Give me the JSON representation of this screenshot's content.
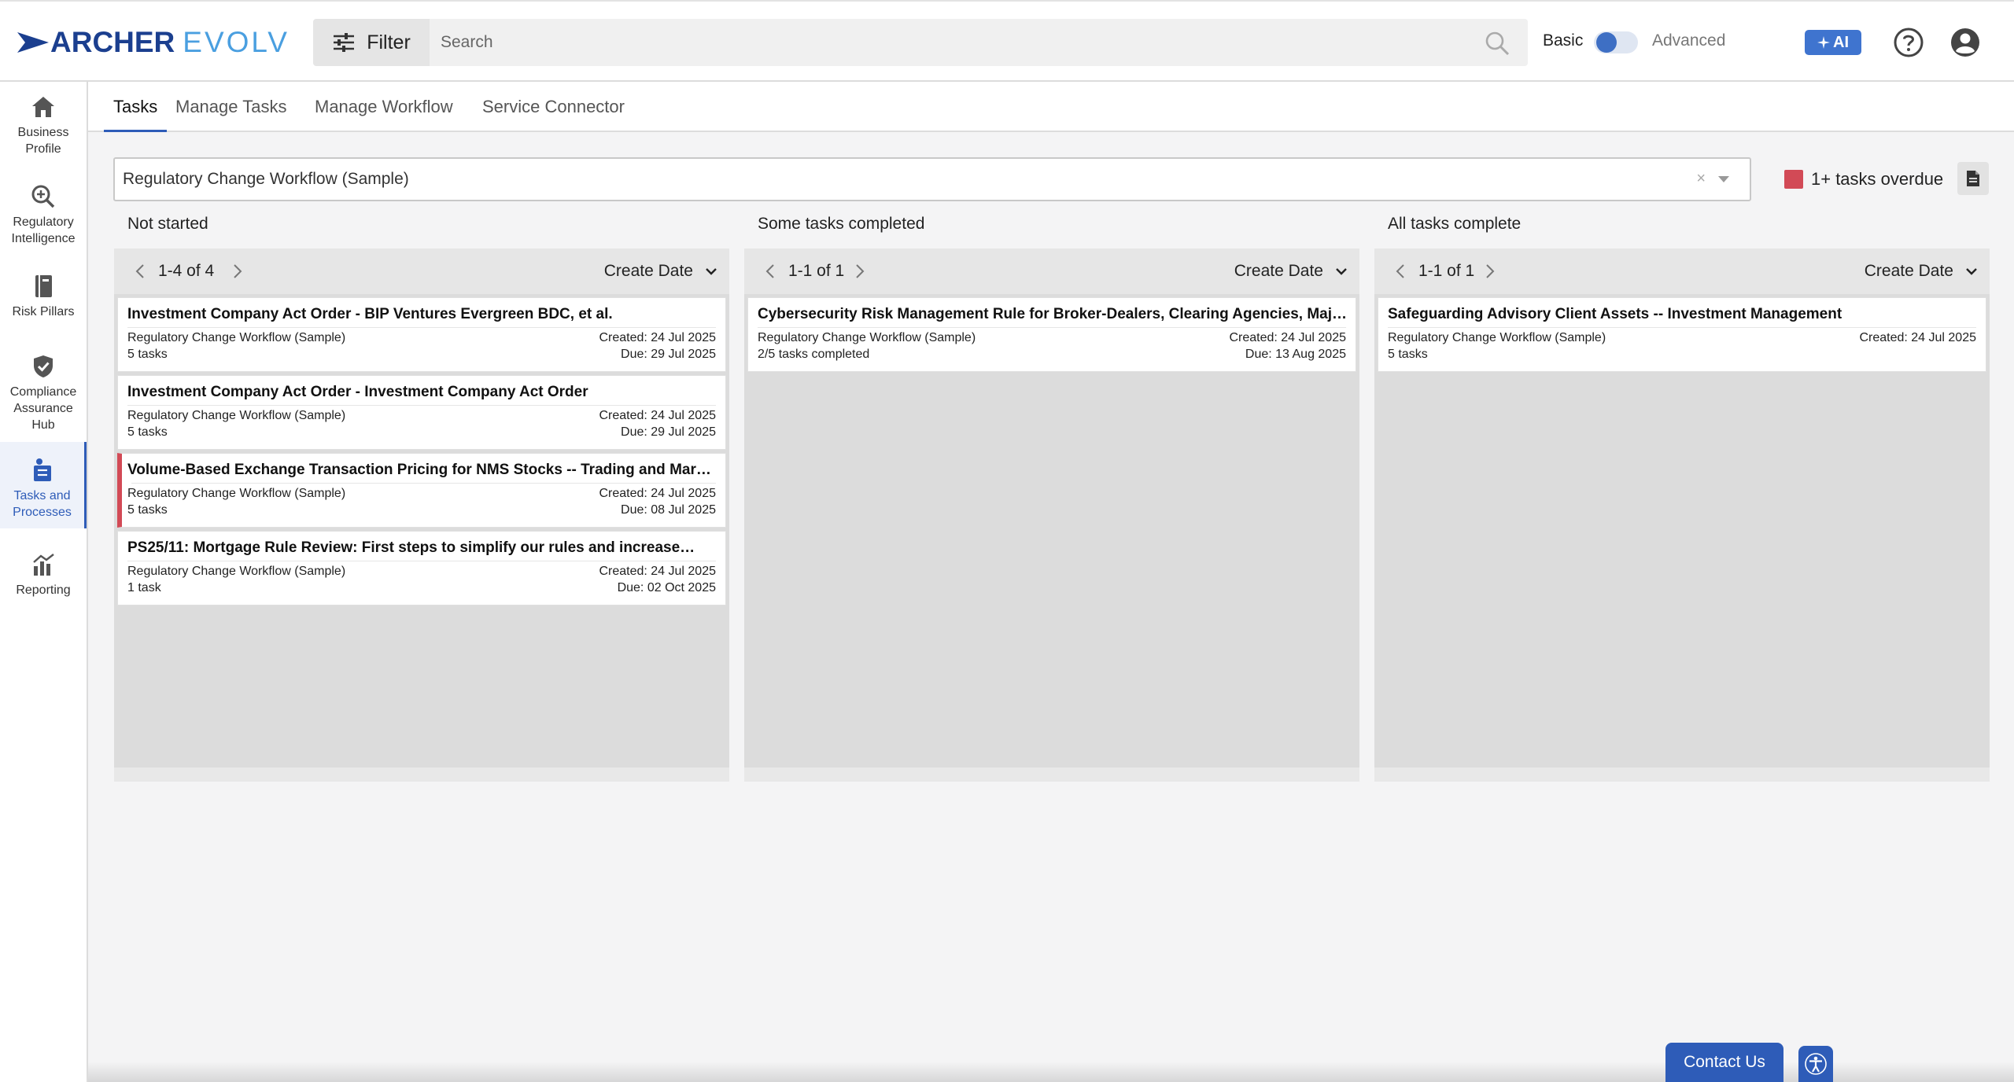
{
  "header": {
    "logo_archer": "ARCHER",
    "logo_evolv": "EVOLV",
    "filter_label": "Filter",
    "search_placeholder": "Search",
    "mode_basic": "Basic",
    "mode_advanced": "Advanced",
    "ai_label": "AI",
    "toggle_state": "basic"
  },
  "sidebar": {
    "items": [
      {
        "label": "Business Profile",
        "icon": "home-icon"
      },
      {
        "label": "Regulatory Intelligence",
        "icon": "magnify-icon"
      },
      {
        "label": "Risk Pillars",
        "icon": "book-icon"
      },
      {
        "label": "Compliance Assurance Hub",
        "icon": "shield-check-icon"
      },
      {
        "label": "Tasks and Processes",
        "icon": "tasks-icon",
        "active": true
      },
      {
        "label": "Reporting",
        "icon": "chart-icon"
      }
    ]
  },
  "tabs": [
    {
      "label": "Tasks",
      "active": true
    },
    {
      "label": "Manage Tasks"
    },
    {
      "label": "Manage Workflow"
    },
    {
      "label": "Service Connector"
    }
  ],
  "workflow_select": {
    "value": "Regulatory Change Workflow (Sample)",
    "clear": "×"
  },
  "legend": {
    "text": "1+ tasks overdue",
    "color": "#d24a56"
  },
  "columns": [
    {
      "title": "Not started",
      "pagination": "1-4 of 4",
      "sort": "Create Date",
      "cards": [
        {
          "title": "Investment Company Act Order - BIP Ventures Evergreen BDC, et al.",
          "workflow": "Regulatory Change Workflow (Sample)",
          "sub": "5 tasks",
          "created": "Created: 24 Jul 2025",
          "due": "Due: 29 Jul 2025",
          "overdue": false
        },
        {
          "title": "Investment Company Act Order - Investment Company Act Order",
          "workflow": "Regulatory Change Workflow (Sample)",
          "sub": "5 tasks",
          "created": "Created: 24 Jul 2025",
          "due": "Due: 29 Jul 2025",
          "overdue": false
        },
        {
          "title": "Volume-Based Exchange Transaction Pricing for NMS Stocks -- Trading and Markets",
          "workflow": "Regulatory Change Workflow (Sample)",
          "sub": "5 tasks",
          "created": "Created: 24 Jul 2025",
          "due": "Due: 08 Jul 2025",
          "overdue": true
        },
        {
          "title": "PS25/11: Mortgage Rule Review: First steps to simplify our rules and increase…",
          "workflow": "Regulatory Change Workflow (Sample)",
          "sub": "1 task",
          "created": "Created: 24 Jul 2025",
          "due": "Due: 02 Oct 2025",
          "overdue": false
        }
      ]
    },
    {
      "title": "Some tasks completed",
      "pagination": "1-1 of 1",
      "sort": "Create Date",
      "cards": [
        {
          "title": "Cybersecurity Risk Management Rule for Broker-Dealers, Clearing Agencies, Major…",
          "workflow": "Regulatory Change Workflow (Sample)",
          "sub": "2/5 tasks completed",
          "created": "Created: 24 Jul 2025",
          "due": "Due: 13 Aug 2025",
          "overdue": false
        }
      ]
    },
    {
      "title": "All tasks complete",
      "pagination": "1-1 of 1",
      "sort": "Create Date",
      "cards": [
        {
          "title": "Safeguarding Advisory Client Assets -- Investment Management",
          "workflow": "Regulatory Change Workflow (Sample)",
          "sub": "5 tasks",
          "created": "Created: 24 Jul 2025",
          "due": "",
          "overdue": false
        }
      ]
    }
  ],
  "footer": {
    "contact_label": "Contact Us"
  },
  "colors": {
    "accent": "#2e5cb8",
    "overdue": "#d24a56",
    "logo_dark": "#1b3f8f",
    "logo_light": "#4a9fe0"
  }
}
